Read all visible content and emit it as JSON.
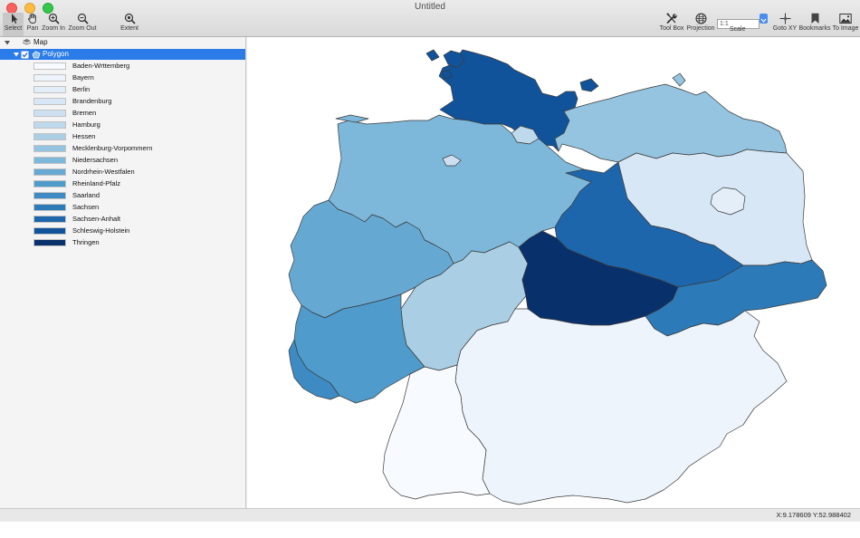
{
  "window": {
    "title": "Untitled"
  },
  "toolbar": {
    "left_tools": [
      {
        "name": "select",
        "label": "Select",
        "icon": "arrow-pointer-icon",
        "active": true
      },
      {
        "name": "pan",
        "label": "Pan",
        "icon": "hand-icon"
      },
      {
        "name": "zoom-in",
        "label": "Zoom In",
        "icon": "zoom-in-icon"
      },
      {
        "name": "zoom-out",
        "label": "Zoom Out",
        "icon": "zoom-out-icon"
      },
      {
        "name": "extent",
        "label": "Extent",
        "icon": "magnifier-icon"
      }
    ],
    "right_tools": [
      {
        "name": "tool-box",
        "label": "Tool Box",
        "icon": "tools-icon"
      },
      {
        "name": "projection",
        "label": "Projection",
        "icon": "globe-icon"
      },
      {
        "name": "goto-xy",
        "label": "Goto XY",
        "icon": "crosshair-icon"
      },
      {
        "name": "bookmarks",
        "label": "Bookmarks",
        "icon": "bookmark-icon"
      },
      {
        "name": "to-image",
        "label": "To Image",
        "icon": "image-icon"
      }
    ],
    "scale": {
      "label": "Scale",
      "value": "1:1"
    }
  },
  "layers": {
    "root": "Map",
    "layer": "Polygon",
    "legend": [
      {
        "label": "Baden-Wrttemberg",
        "color": "#f7fbff"
      },
      {
        "label": "Bayern",
        "color": "#edf4fc"
      },
      {
        "label": "Berlin",
        "color": "#e3eef9"
      },
      {
        "label": "Brandenburg",
        "color": "#d8e7f5"
      },
      {
        "label": "Bremen",
        "color": "#cde0f1"
      },
      {
        "label": "Hamburg",
        "color": "#bed8ec"
      },
      {
        "label": "Hessen",
        "color": "#aacfe5"
      },
      {
        "label": "Mecklenburg-Vorpommern",
        "color": "#94c4df"
      },
      {
        "label": "Niedersachsen",
        "color": "#7db8da"
      },
      {
        "label": "Nordrhein-Westfalen",
        "color": "#65a9d3"
      },
      {
        "label": "Rheinland-Pfalz",
        "color": "#4f9bcb"
      },
      {
        "label": "Saarland",
        "color": "#3d8bc2"
      },
      {
        "label": "Sachsen",
        "color": "#2d7ab8"
      },
      {
        "label": "Sachsen-Anhalt",
        "color": "#1e66ac"
      },
      {
        "label": "Schleswig-Holstein",
        "color": "#11539a"
      },
      {
        "label": "Thringen",
        "color": "#08306b"
      }
    ]
  },
  "map": {
    "states": [
      {
        "name": "Schleswig-Holstein",
        "color": "#11539a"
      },
      {
        "name": "Hamburg",
        "color": "#bed8ec"
      },
      {
        "name": "Mecklenburg-Vorpommern",
        "color": "#94c4df"
      },
      {
        "name": "Niedersachsen",
        "color": "#7db8da"
      },
      {
        "name": "Bremen",
        "color": "#cde0f1"
      },
      {
        "name": "Brandenburg",
        "color": "#d8e7f5"
      },
      {
        "name": "Berlin",
        "color": "#e3eef9"
      },
      {
        "name": "Sachsen-Anhalt",
        "color": "#1e66ac"
      },
      {
        "name": "Nordrhein-Westfalen",
        "color": "#65a9d3"
      },
      {
        "name": "Hessen",
        "color": "#aacfe5"
      },
      {
        "name": "Thringen",
        "color": "#08306b"
      },
      {
        "name": "Sachsen",
        "color": "#2d7ab8"
      },
      {
        "name": "Rheinland-Pfalz",
        "color": "#4f9bcb"
      },
      {
        "name": "Saarland",
        "color": "#3d8bc2"
      },
      {
        "name": "Bayern",
        "color": "#edf4fc"
      },
      {
        "name": "Baden-Wrttemberg",
        "color": "#f7fbff"
      }
    ]
  },
  "status": {
    "coordinates": "X:9.178609 Y:52.988402"
  }
}
